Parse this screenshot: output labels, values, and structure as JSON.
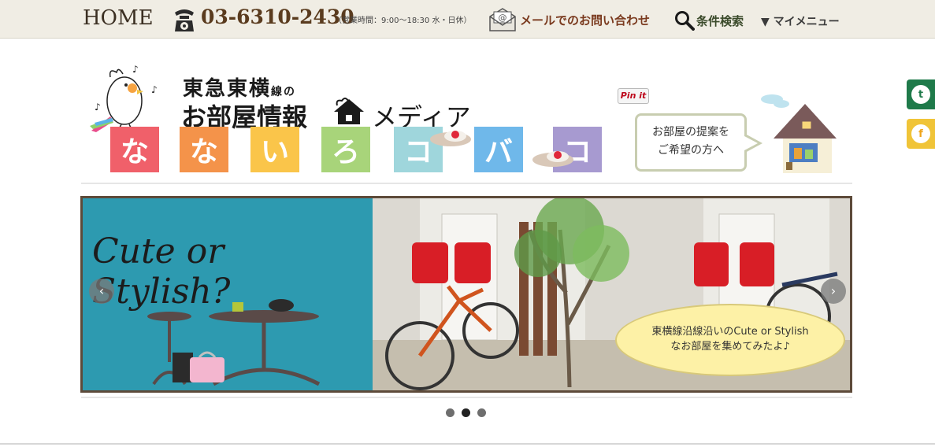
{
  "header": {
    "home_label": "HOME",
    "phone": "03-6310-2430",
    "hours": "（営業時間：9:00〜18:30 水・日休）",
    "mail_label": "メールでのお問い合わせ",
    "search_label": "条件検索",
    "mymenu_label": "▼ マイメニュー"
  },
  "logo": {
    "line1": "東急東横",
    "line1_suffix": "線の",
    "line2": "お部屋情報",
    "media": "メディア",
    "tiles": [
      "な",
      "な",
      "い",
      "ろ",
      "コ",
      "バ",
      "コ"
    ],
    "tile_colors": [
      "#f0606a",
      "#f4934a",
      "#fac54a",
      "#a8d47a",
      "#9fd6dc",
      "#6fb8ea",
      "#a79ad0"
    ]
  },
  "pinit_label": "Pin it",
  "proposal": {
    "line1": "お部屋の提案を",
    "line2": "ご希望の方へ"
  },
  "social": {
    "twitter_glyph": "t",
    "facebook_glyph": "f"
  },
  "slider": {
    "headline": "Cute or Stylish?",
    "caption_line1": "東横線沿線沿いのCute or Stylish",
    "caption_line2": "なお部屋を集めてみたよ♪",
    "prev_glyph": "‹",
    "next_glyph": "›",
    "dots_count": 3,
    "active_dot": 2
  }
}
